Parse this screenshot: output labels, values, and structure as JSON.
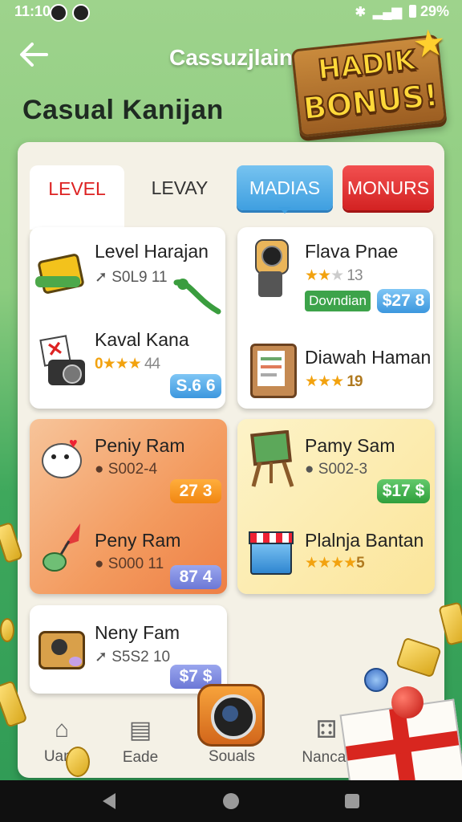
{
  "status_bar": {
    "time": "11:10",
    "battery": "29%"
  },
  "header": {
    "app_title": "Cassuzjlain",
    "page_title": "Casual Kanijan"
  },
  "bonus_badge": {
    "line1": "HADIK",
    "line2": "BONUS!"
  },
  "tabs": [
    {
      "label": "LEVEL"
    },
    {
      "label": "LEVAY"
    },
    {
      "label": "MADIAS"
    },
    {
      "label": "MONURS"
    }
  ],
  "cards": {
    "c1": {
      "name": "Level Harajan",
      "sub": "S0L9 11"
    },
    "c2": {
      "name": "Kaval Kana",
      "rating_text": "0",
      "rating_num": "44",
      "price": "S.6 6"
    },
    "c3": {
      "name": "Flava Pnae",
      "rating_num": "13",
      "tag": "Dovndian",
      "price": "$27 8"
    },
    "c4": {
      "name": "Diawah Haman",
      "rating_num": "19"
    },
    "c5": {
      "name": "Peniy Ram",
      "sub": "S002-4",
      "price": "27 3"
    },
    "c6": {
      "name": "Peny Ram",
      "sub": "S000 11",
      "price": "87 4"
    },
    "c7": {
      "name": "Pamy Sam",
      "sub": "S002-3",
      "price": "$17 $"
    },
    "c8": {
      "name": "Plalnja Bantan",
      "rating_num": "5"
    },
    "c9": {
      "name": "Neny Fam",
      "sub": "S5S2 10",
      "price": "$7 $"
    }
  },
  "bottom_nav": [
    {
      "label": "Uans",
      "icon": "home-icon"
    },
    {
      "label": "Eade",
      "icon": "trade-icon"
    },
    {
      "label": "Souals",
      "icon": "camera-icon"
    },
    {
      "label": "Nancar",
      "icon": "grid-icon"
    }
  ],
  "colors": {
    "accent_red": "#d22222",
    "accent_blue": "#3f9fe0",
    "bg_green": "#8ccc7f"
  }
}
